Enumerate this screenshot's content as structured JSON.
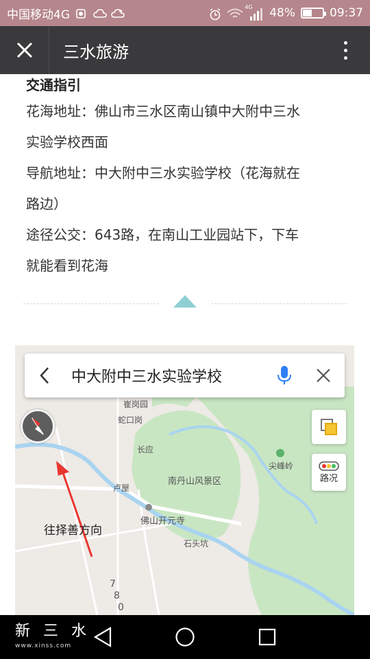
{
  "status_bar": {
    "carrier": "中国移动4G",
    "network": "4G",
    "battery": "48%",
    "battery_level": 0.48,
    "time": "09:37"
  },
  "header": {
    "title": "三水旅游",
    "close_icon": "close-icon",
    "more_icon": "more-vertical-icon"
  },
  "article": {
    "section_title": "交通指引",
    "paragraphs": [
      {
        "line1": "花海地址：佛山市三水区南山镇中大附中三水",
        "line2": "实验学校西面"
      },
      {
        "line1": "导航地址：中大附中三水实验学校（花海就在",
        "line2": "路边）"
      },
      {
        "line1": "途径公交：643路，在南山工业园站下，下车",
        "line2": "就能看到花海"
      }
    ]
  },
  "divider": {
    "accent": "#8fcfd4"
  },
  "map": {
    "search_text": "中大附中三水实验学校",
    "traffic_label": "路况",
    "annotation": "往择善方向",
    "places": {
      "scenic": "南丹山风景区",
      "temple": "佛山开元寺",
      "peak": "尖峰岭",
      "stone": "石头坑",
      "village1": "崔岗园",
      "village2": "蛇口岗",
      "village3": "长应",
      "village4": "卢屋",
      "road_digits": [
        "7",
        "8",
        "0"
      ]
    },
    "colors": {
      "water": "#a9d4f0",
      "green": "#c9e6c3",
      "arrow": "#e8362f",
      "mic": "#2f7ff3"
    }
  },
  "nav_bar": {
    "brand_name": "新 三 水",
    "brand_site": "www.xinss.com"
  }
}
